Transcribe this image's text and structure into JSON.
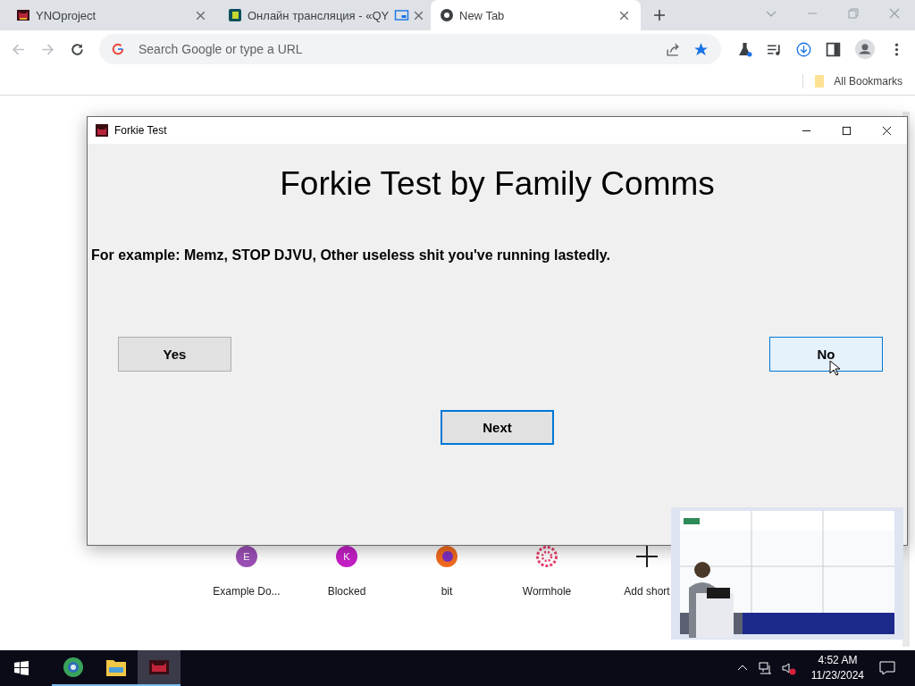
{
  "browser": {
    "tabs": [
      {
        "title": "YNOproject",
        "selected": false
      },
      {
        "title": "Онлайн трансляция - «QY",
        "selected": false
      },
      {
        "title": "New Tab",
        "selected": true
      }
    ],
    "omnibox": {
      "placeholder": "Search Google or type a URL"
    },
    "bookmarks_bar": {
      "folder": "All Bookmarks"
    }
  },
  "shortcuts": [
    {
      "label": "Example Do...",
      "kind": "letter",
      "letter": "E",
      "color": "#9b4fb5"
    },
    {
      "label": "Blocked",
      "kind": "letter",
      "letter": "K",
      "color": "#c41fc6"
    },
    {
      "label": "bit",
      "kind": "fox"
    },
    {
      "label": "Wormhole",
      "kind": "spiral"
    },
    {
      "label": "Add short",
      "kind": "add"
    }
  ],
  "dialog": {
    "title": "Forkie Test",
    "heading": "Forkie Test by Family Comms",
    "text": "For example: Memz, STOP DJVU, Other useless shit you've running lastedly.",
    "buttons": [
      {
        "label": "Yes",
        "hovered": false,
        "focused": false
      },
      {
        "label": "No",
        "hovered": true,
        "focused": false
      },
      {
        "label": "Next",
        "hovered": false,
        "focused": true
      }
    ]
  },
  "taskbar": {
    "apps": [
      {
        "kind": "browser",
        "selected": false
      },
      {
        "kind": "folder",
        "selected": false
      },
      {
        "kind": "app",
        "selected": true
      }
    ],
    "time": "4:52 AM",
    "date": "11/23/2024"
  }
}
